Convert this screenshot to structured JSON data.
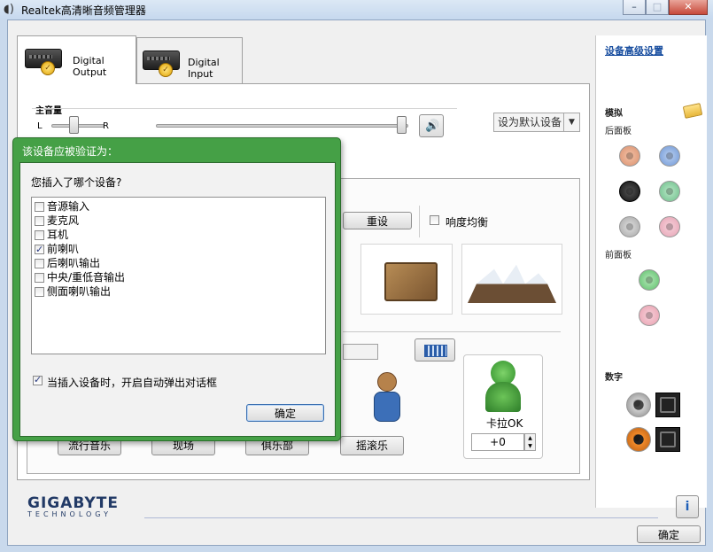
{
  "window": {
    "title": "Realtek高清晰音频管理器",
    "minimize_glyph": "–",
    "maximize_glyph": "□",
    "close_glyph": "✕"
  },
  "tabs": [
    {
      "label": "Digital Output",
      "active": true,
      "icon": "digital-output-device-icon"
    },
    {
      "label": "Digital Input",
      "active": false,
      "icon": "digital-input-device-icon"
    }
  ],
  "volume": {
    "title": "主音量",
    "left_label": "L",
    "right_label": "R",
    "balance": 0.5,
    "level": 1.0,
    "speaker_glyph": "🔊",
    "default_device_combo": "设为默认设备",
    "combo_arrow": "▼"
  },
  "effects": {
    "reset_button": "重设",
    "loudness_label": "响度均衡",
    "loudness_checked": false,
    "preset_buttons": [
      "流行音乐",
      "现场",
      "俱乐部",
      "摇滚乐"
    ],
    "karaoke_label": "卡拉OK",
    "karaoke_value": "+0"
  },
  "side_panel": {
    "advanced_link": "设备高级设置",
    "analog_title": "模拟",
    "back_panel_label": "后面板",
    "front_panel_label": "前面板",
    "digital_title": "数字",
    "colors": {
      "orange": "#d9906e",
      "blue": "#6f97d6",
      "black": "#1a1a1a",
      "green": "#6cbf8a",
      "gray": "#a8a8a8",
      "pink": "#e6a3b4",
      "front_green": "#5cc06a",
      "front_pink": "#e8a0b0"
    }
  },
  "footer": {
    "brand_name": "GIGABYTE",
    "brand_sub": "TECHNOLOGY",
    "info_glyph": "i",
    "ok_button": "确定"
  },
  "dialog": {
    "title": "该设备应被验证为：",
    "question": "您插入了哪个设备?",
    "devices": [
      {
        "label": "音源输入",
        "checked": false
      },
      {
        "label": "麦克风",
        "checked": false
      },
      {
        "label": "耳机",
        "checked": false
      },
      {
        "label": "前喇叭",
        "checked": true
      },
      {
        "label": "后喇叭输出",
        "checked": false
      },
      {
        "label": "中央/重低音输出",
        "checked": false
      },
      {
        "label": "侧面喇叭输出",
        "checked": false
      }
    ],
    "auto_popup_label": "当插入设备时，开启自动弹出对话框",
    "auto_popup_checked": true,
    "ok_button": "确定"
  }
}
